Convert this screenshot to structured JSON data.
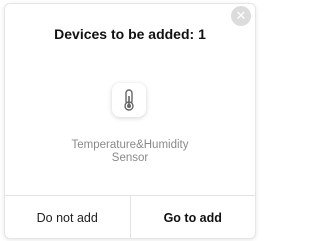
{
  "dialog": {
    "title": "Devices to be added: 1",
    "close_icon": "close-icon",
    "device": {
      "icon": "thermometer-icon",
      "name_line1": "Temperature&Humidity",
      "name_line2": "Sensor"
    },
    "buttons": {
      "cancel_label": "Do not add",
      "confirm_label": "Go to add"
    }
  }
}
